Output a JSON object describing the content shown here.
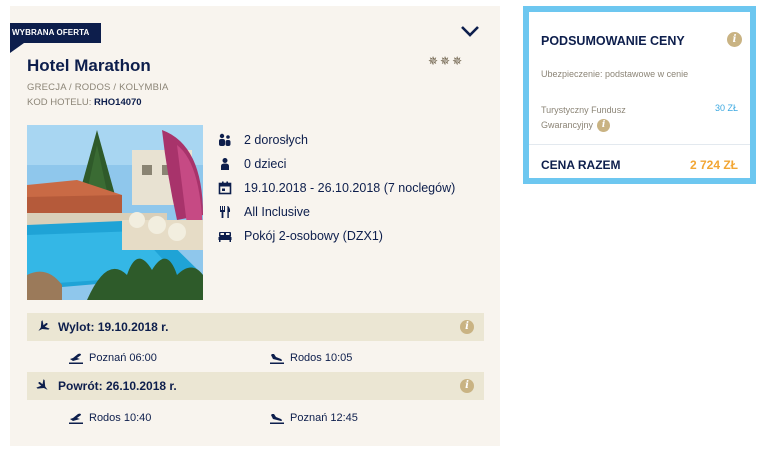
{
  "offer": {
    "ribbon": "WYBRANA OFERTA",
    "hotel_name": "Hotel Marathon",
    "stars": "✵✵✵",
    "location": "GRECJA / RODOS / KOLYMBIA",
    "code_label": "KOD HOTELU:",
    "code_value": "RHO14070",
    "details": {
      "adults": "2 dorosłych",
      "children": "0 dzieci",
      "dates": "19.10.2018 - 26.10.2018 (7 noclegów)",
      "board": "All Inclusive",
      "room": "Pokój 2-osobowy (DZX1)"
    }
  },
  "flights": {
    "outbound": {
      "label": "Wylot: 19.10.2018 r.",
      "depart": "Poznań 06:00",
      "arrive": "Rodos 10:05"
    },
    "return": {
      "label": "Powrót: 26.10.2018 r.",
      "depart": "Rodos 10:40",
      "arrive": "Poznań 12:45"
    }
  },
  "summary": {
    "title": "PODSUMOWANIE CENY",
    "insurance": "Ubezpieczenie: podstawowe w cenie",
    "fund_label": "Turystyczny Fundusz Gwarancyjny",
    "fund_value": "30 ZŁ",
    "total_label": "CENA RAZEM",
    "total_value": "2 724 ZŁ"
  },
  "icons": {
    "info": "i"
  },
  "colors": {
    "navy": "#0d1e4c",
    "accent_blue": "#6dc7f0",
    "price_orange": "#f2a634",
    "info_gold": "#c9b383",
    "card_bg": "#f8f4ee",
    "flight_bar": "#ebe6d3"
  }
}
